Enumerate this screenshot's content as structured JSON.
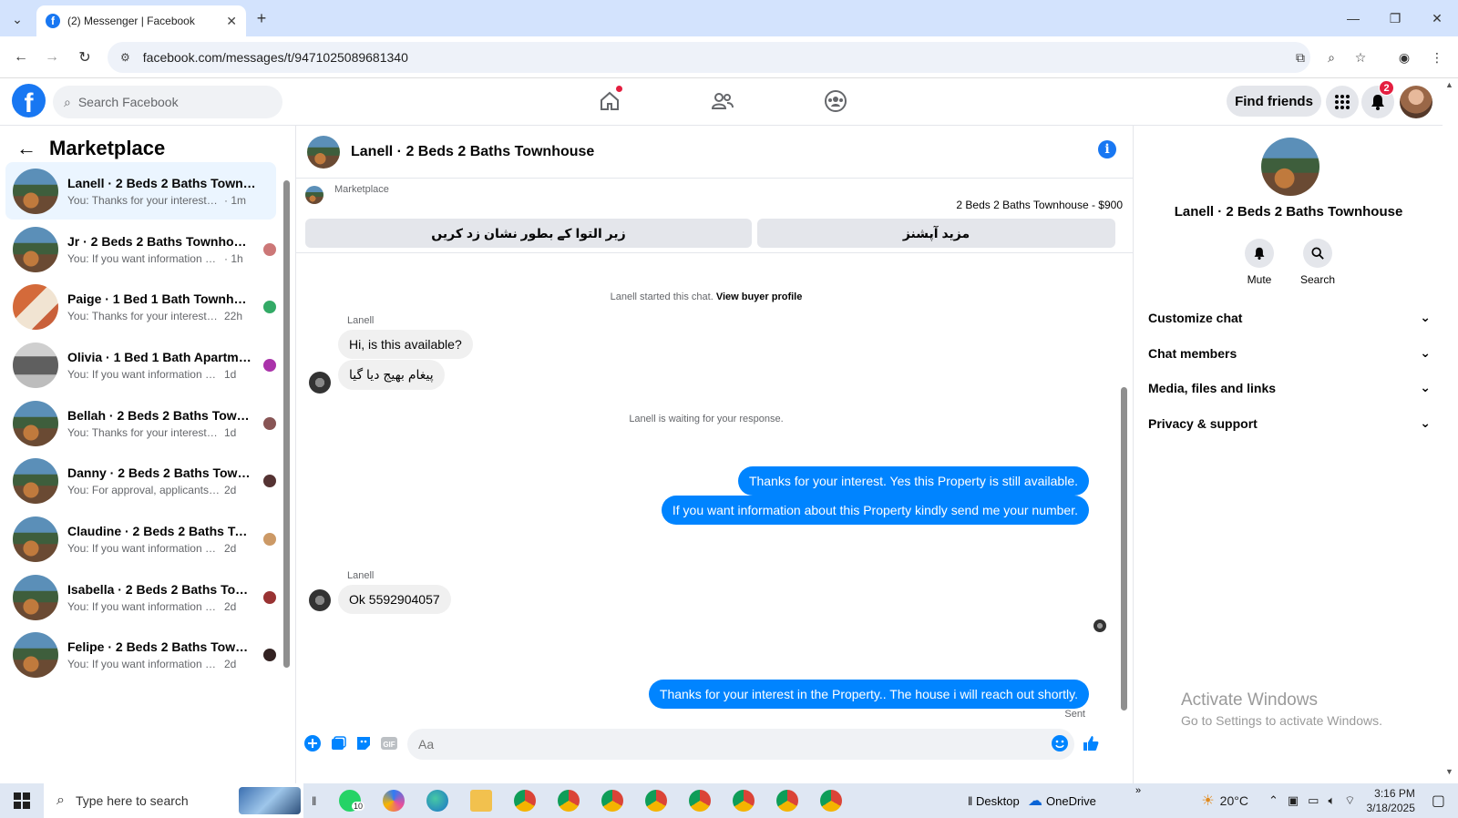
{
  "browser": {
    "tab_title": "(2) Messenger | Facebook",
    "url": "facebook.com/messages/t/9471025089681340"
  },
  "fb": {
    "search_placeholder": "Search Facebook",
    "find_friends": "Find friends",
    "notification_count": "2"
  },
  "left": {
    "title": "Marketplace",
    "conversations": [
      {
        "name": "Lanell · 2 Beds 2 Baths Townhou...",
        "preview": "You: Thanks for your interest in th...",
        "time": "· 1m"
      },
      {
        "name": "Jr · 2 Beds 2 Baths Townhouse",
        "preview": "You: If you want information ab...",
        "time": "· 1h"
      },
      {
        "name": "Paige · 1 Bed 1 Bath Townhouse",
        "preview": "You: Thanks for your interest in...",
        "time": "22h"
      },
      {
        "name": "Olivia · 1 Bed 1 Bath Apartme...",
        "preview": "You: If you want information ab...",
        "time": "1d"
      },
      {
        "name": "Bellah · 2 Beds 2 Baths Townh...",
        "preview": "You: Thanks for your interest in t...",
        "time": "1d"
      },
      {
        "name": "Danny · 2 Beds 2 Baths Town...",
        "preview": "You: For approval, applicants ne...",
        "time": "2d"
      },
      {
        "name": "Claudine · 2 Beds 2 Baths Tow...",
        "preview": "You: If you want information ab...",
        "time": "2d"
      },
      {
        "name": "Isabella · 2 Beds 2 Baths Town...",
        "preview": "You: If you want information ab...",
        "time": "2d"
      },
      {
        "name": "Felipe · 2 Beds 2 Baths Townh...",
        "preview": "You: If you want information ab...",
        "time": "2d"
      }
    ]
  },
  "chat": {
    "title": "Lanell · 2 Beds 2 Baths Townhouse",
    "marketplace_label": "Marketplace",
    "listing": "2 Beds 2 Baths Townhouse - $900",
    "btn_mark_pending": "زیر التوا کے بطور نشان زد کریں",
    "btn_more_actions": "مزید آپشنز",
    "started_text": "Lanell started this chat.",
    "view_profile": "View buyer profile",
    "sender_name": "Lanell",
    "msg_in_1": "Hi, is this available?",
    "msg_in_2": "پیغام بھیج دیا گیا",
    "waiting_text": "Lanell is waiting for your response.",
    "msg_out_1": "Thanks for your interest. Yes this Property is still available.",
    "msg_out_2": "If you want information about this Property kindly send me your number.",
    "sender_name_2": "Lanell",
    "msg_in_3": "Ok 5592904057",
    "msg_out_3": "Thanks for your interest in the Property.. The house i will reach  out shortly.",
    "sent_label": "Sent",
    "input_placeholder": "Aa"
  },
  "right": {
    "name": "Lanell · 2 Beds 2 Baths Townhouse",
    "mute": "Mute",
    "search": "Search",
    "sections": [
      "Customize chat",
      "Chat members",
      "Media, files and links",
      "Privacy & support"
    ]
  },
  "watermark": {
    "line1": "Activate Windows",
    "line2": "Go to Settings to activate Windows."
  },
  "taskbar": {
    "search_placeholder": "Type here to search",
    "desktop": "Desktop",
    "onedrive": "OneDrive",
    "temperature": "20°C",
    "time": "3:16 PM",
    "date": "3/18/2025",
    "whatsapp_badge": "10"
  }
}
